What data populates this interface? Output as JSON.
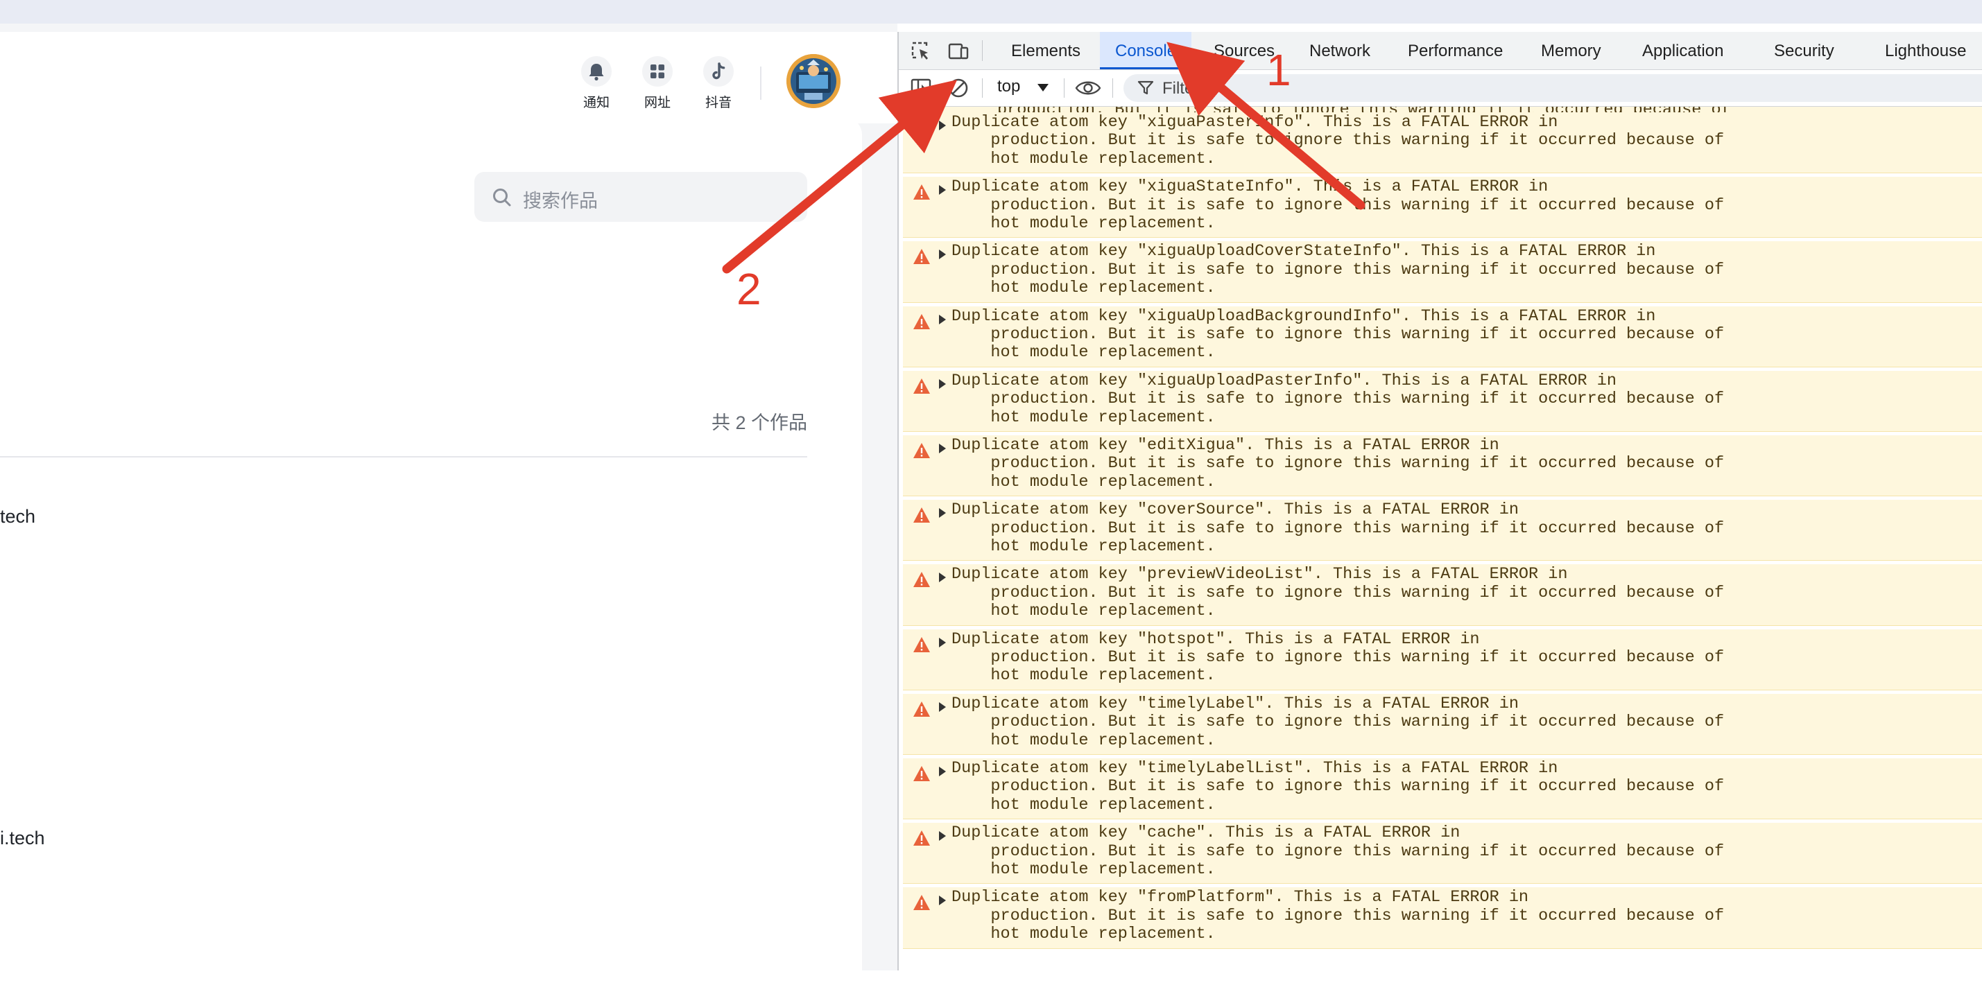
{
  "header": {
    "icons": [
      {
        "name": "bell-icon",
        "label": "通知"
      },
      {
        "name": "grid-icon",
        "label": "网址"
      },
      {
        "name": "tiktok-icon",
        "label": "抖音"
      }
    ]
  },
  "main": {
    "search_placeholder": "搜索作品",
    "count_text": "共 2 个作品",
    "items": [
      "tech",
      "i.tech"
    ]
  },
  "devtools": {
    "tabs": [
      "Elements",
      "Console",
      "Sources",
      "Network",
      "Performance",
      "Memory",
      "Application",
      "Security",
      "Lighthouse"
    ],
    "active_tab": "Console",
    "context": "top",
    "filter_label": "Filter",
    "first_partial": "production. But it is safe to ignore this warning if it occurred because of\nhot module replacement.",
    "messages": [
      "Duplicate atom key \"xiguaPasterInfo\". This is a FATAL ERROR in\n    production. But it is safe to ignore this warning if it occurred because of\n    hot module replacement.",
      "Duplicate atom key \"xiguaStateInfo\". This is a FATAL ERROR in\n    production. But it is safe to ignore this warning if it occurred because of\n    hot module replacement.",
      "Duplicate atom key \"xiguaUploadCoverStateInfo\". This is a FATAL ERROR in\n    production. But it is safe to ignore this warning if it occurred because of\n    hot module replacement.",
      "Duplicate atom key \"xiguaUploadBackgroundInfo\". This is a FATAL ERROR in\n    production. But it is safe to ignore this warning if it occurred because of\n    hot module replacement.",
      "Duplicate atom key \"xiguaUploadPasterInfo\". This is a FATAL ERROR in\n    production. But it is safe to ignore this warning if it occurred because of\n    hot module replacement.",
      "Duplicate atom key \"editXigua\". This is a FATAL ERROR in\n    production. But it is safe to ignore this warning if it occurred because of\n    hot module replacement.",
      "Duplicate atom key \"coverSource\". This is a FATAL ERROR in\n    production. But it is safe to ignore this warning if it occurred because of\n    hot module replacement.",
      "Duplicate atom key \"previewVideoList\". This is a FATAL ERROR in\n    production. But it is safe to ignore this warning if it occurred because of\n    hot module replacement.",
      "Duplicate atom key \"hotspot\". This is a FATAL ERROR in\n    production. But it is safe to ignore this warning if it occurred because of\n    hot module replacement.",
      "Duplicate atom key \"timelyLabel\". This is a FATAL ERROR in\n    production. But it is safe to ignore this warning if it occurred because of\n    hot module replacement.",
      "Duplicate atom key \"timelyLabelList\". This is a FATAL ERROR in\n    production. But it is safe to ignore this warning if it occurred because of\n    hot module replacement.",
      "Duplicate atom key \"cache\". This is a FATAL ERROR in\n    production. But it is safe to ignore this warning if it occurred because of\n    hot module replacement.",
      "Duplicate atom key \"fromPlatform\". This is a FATAL ERROR in\n    production. But it is safe to ignore this warning if it occurred because of\n    hot module replacement."
    ]
  },
  "annotations": {
    "label_1": "1",
    "label_2": "2",
    "color": "#e23b2a"
  }
}
